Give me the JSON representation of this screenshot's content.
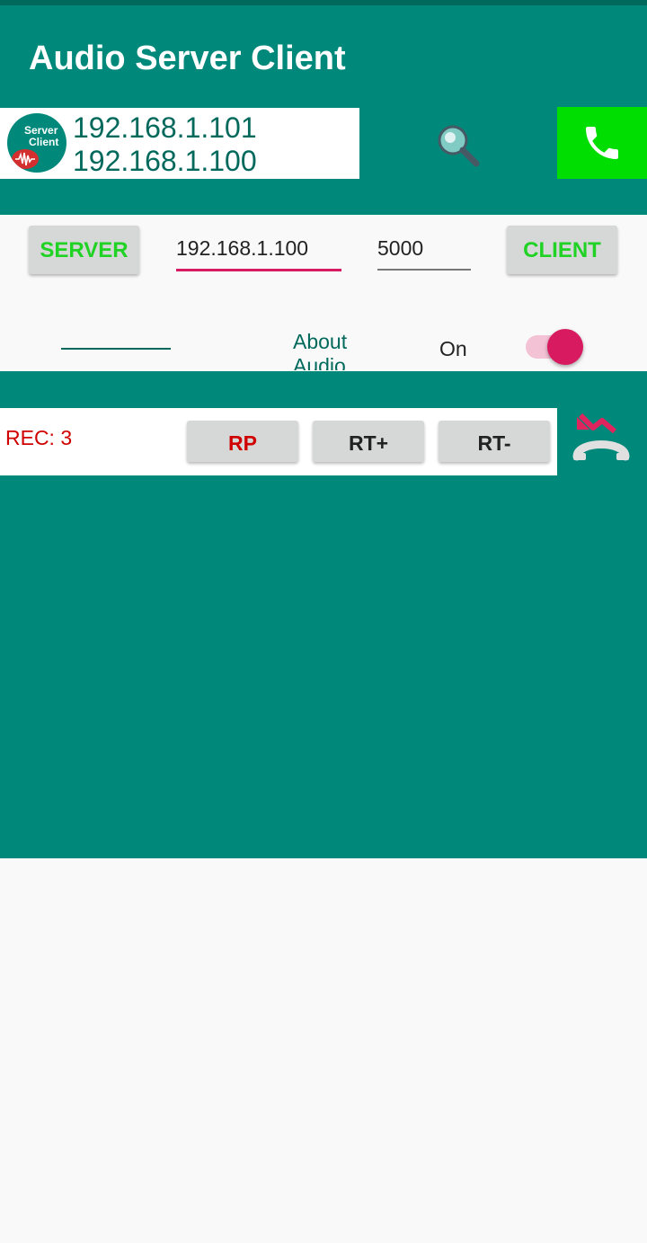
{
  "app": {
    "title": "Audio Server Client"
  },
  "logo": {
    "line1": "Server",
    "line2": "Client"
  },
  "ips": [
    "192.168.1.101",
    "192.168.1.100"
  ],
  "icons": {
    "search": "search-icon",
    "call": "phone-icon",
    "hangup": "hangup-icon"
  },
  "connection": {
    "server_label": "SERVER",
    "client_label": "CLIENT",
    "ip_value": "192.168.1.100",
    "port_value": "5000"
  },
  "options": {
    "about_label": "About Audio",
    "switch_label": "On",
    "switch_on": true
  },
  "recording": {
    "rec_label": "REC: 3",
    "rp_label": "RP",
    "rtplus_label": "RT+",
    "rtminus_label": "RT-"
  },
  "colors": {
    "primary": "#00897b",
    "primary_dark": "#00695c",
    "call_green": "#00dd00",
    "accent": "#d81b60",
    "button_text_green": "#1fd224",
    "rec_red": "#d00000"
  }
}
